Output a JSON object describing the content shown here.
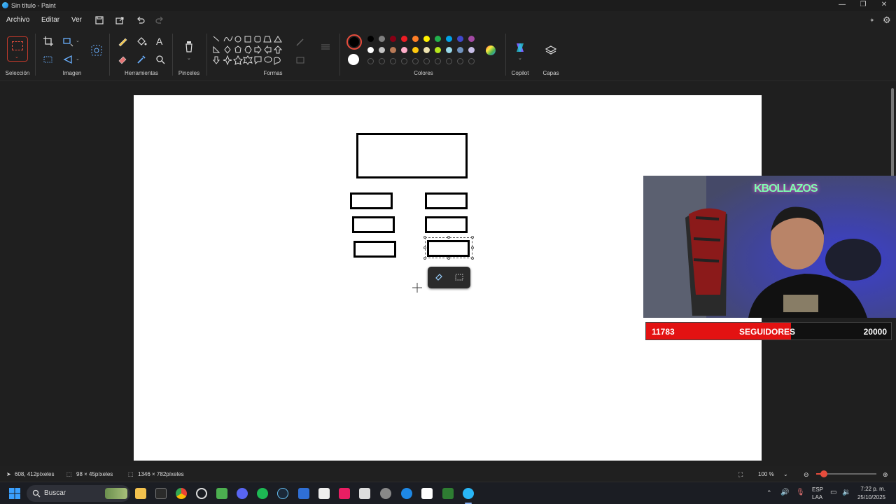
{
  "window": {
    "title": "Sin título - Paint",
    "minimize": "—",
    "maximize": "❐",
    "close": "✕"
  },
  "menu": {
    "archivo": "Archivo",
    "editar": "Editar",
    "ver": "Ver"
  },
  "ribbon": {
    "groups": {
      "seleccion": "Selección",
      "imagen": "Imagen",
      "herramientas": "Herramientas",
      "pinceles": "Pinceles",
      "formas": "Formas",
      "colores": "Colores",
      "copilot": "Copilot",
      "capas": "Capas"
    },
    "text_tool": "A",
    "colors_row1": [
      "#000000",
      "#7f7f7f",
      "#880015",
      "#ed1c24",
      "#ff7f27",
      "#fff200",
      "#22b14c",
      "#00a2e8",
      "#3f48cc",
      "#a349a4"
    ],
    "colors_row2": [
      "#ffffff",
      "#c3c3c3",
      "#b97a57",
      "#ffaec9",
      "#ffc90e",
      "#efe4b0",
      "#b5e61d",
      "#99d9ea",
      "#7092be",
      "#c8bfe7"
    ],
    "primary_color": "#000000",
    "secondary_color": "#ffffff"
  },
  "overlay": {
    "followers_current": "11783",
    "followers_label": "SEGUIDORES",
    "followers_goal": "20000",
    "followers_progress": 0.59,
    "neon_sign": "KBOLLAZOS"
  },
  "status": {
    "cursor_pos": "608, 412píxeles",
    "selection_size": "98 × 45píxeles",
    "canvas_size": "1346 × 782píxeles",
    "zoom": "100 %"
  },
  "taskbar": {
    "search_placeholder": "Buscar",
    "lang_top": "ESP",
    "lang_bottom": "LAA",
    "time": "7:22 p. m.",
    "date": "25/10/2025"
  }
}
